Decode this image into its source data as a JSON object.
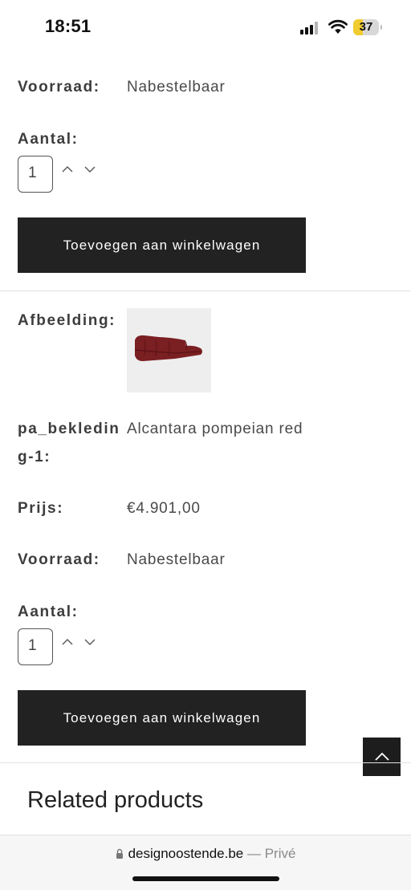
{
  "status_bar": {
    "time": "18:51",
    "battery": "37",
    "battery_level": 0.37
  },
  "product_top": {
    "stock_label": "Voorraad:",
    "stock_value": "Nabestelbaar",
    "qty_label": "Aantal:",
    "qty_value": "1",
    "add_button": "Toevoegen aan winkelwagen"
  },
  "product_second": {
    "image_label": "Afbeelding:",
    "attr_label_line1": "pa_bekledin",
    "attr_label_line2": "g-1:",
    "attr_value": "Alcantara pompeian red",
    "price_label": "Prijs:",
    "price_value": "€4.901,00",
    "stock_label": "Voorraad:",
    "stock_value": "Nabestelbaar",
    "qty_label": "Aantal:",
    "qty_value": "1",
    "add_button": "Toevoegen aan winkelwagen"
  },
  "related": {
    "title": "Related products"
  },
  "browser": {
    "domain": "designoostende.be",
    "separator": " — ",
    "mode": "Privé"
  },
  "colors": {
    "button_bg": "#222222",
    "sofa": "#7a1f22",
    "thumb_bg": "#eeeeee",
    "battery": "#f0cc30"
  }
}
